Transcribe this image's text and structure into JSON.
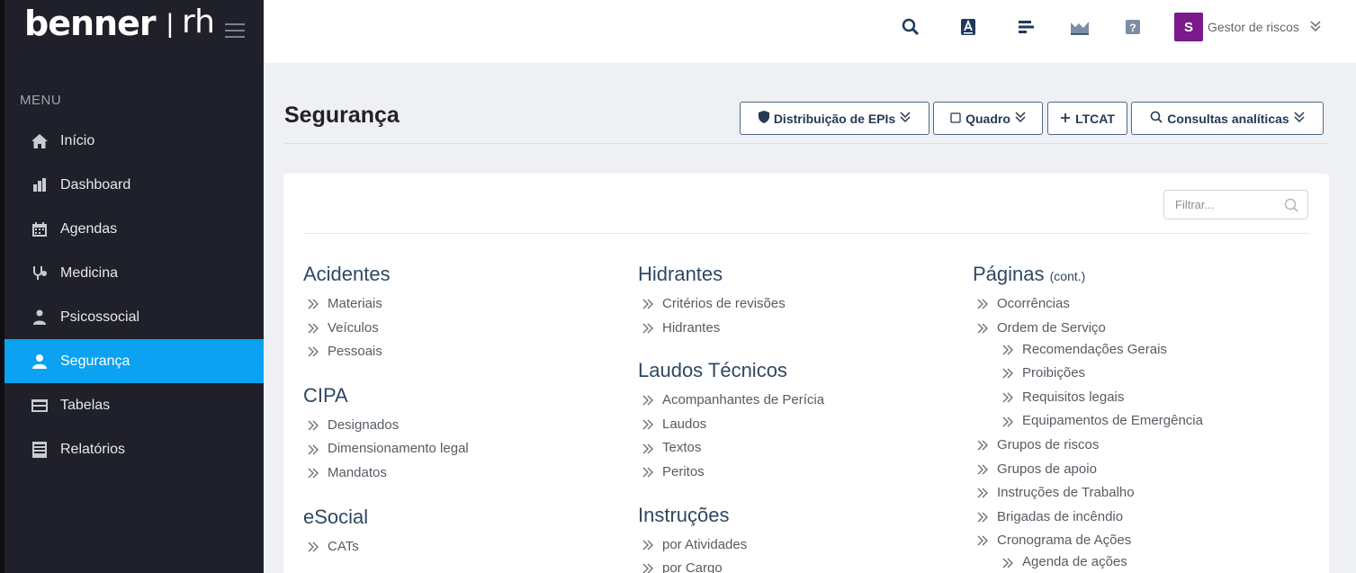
{
  "brand": {
    "name": "benner",
    "separator": "|",
    "product": "rh"
  },
  "sidebar": {
    "menu_title": "MENU",
    "items": [
      {
        "label": "Início",
        "icon": "home-icon"
      },
      {
        "label": "Dashboard",
        "icon": "bar-chart-icon"
      },
      {
        "label": "Agendas",
        "icon": "calendar-icon"
      },
      {
        "label": "Medicina",
        "icon": "stethoscope-icon"
      },
      {
        "label": "Psicossocial",
        "icon": "people-icon"
      },
      {
        "label": "Segurança",
        "icon": "user-icon",
        "active": true
      },
      {
        "label": "Tabelas",
        "icon": "table-icon"
      },
      {
        "label": "Relatórios",
        "icon": "report-icon"
      }
    ]
  },
  "topbar": {
    "icons": [
      "search-icon",
      "font-icon",
      "list-icon",
      "chart-icon",
      "help-icon"
    ],
    "user": {
      "initial": "S",
      "name": "Gestor de riscos"
    }
  },
  "page": {
    "title": "Segurança",
    "buttons": {
      "epis": "Distribuição de EPIs",
      "quadro": "Quadro",
      "ltcat": "LTCAT",
      "consultas": "Consultas analíticas"
    }
  },
  "filter": {
    "placeholder": "Filtrar..."
  },
  "sections": {
    "acidentes": {
      "title": "Acidentes",
      "links": [
        "Materiais",
        "Veículos",
        "Pessoais"
      ]
    },
    "cipa": {
      "title": "CIPA",
      "links": [
        "Designados",
        "Dimensionamento legal",
        "Mandatos"
      ]
    },
    "esocial": {
      "title": "eSocial",
      "links": [
        "CATs"
      ]
    },
    "hidrantes": {
      "title": "Hidrantes",
      "links": [
        "Critérios de revisões",
        "Hidrantes"
      ]
    },
    "laudos": {
      "title": "Laudos Técnicos",
      "links": [
        "Acompanhantes de Perícia",
        "Laudos",
        "Textos",
        "Peritos"
      ]
    },
    "instrucoes": {
      "title": "Instruções",
      "links": [
        "por Atividades",
        "por Cargo"
      ]
    },
    "paginas": {
      "title": "Páginas",
      "cont": "(cont.)",
      "links": [
        "Ocorrências",
        "Ordem de Serviço",
        "Recomendações Gerais",
        "Proibições",
        "Requisitos legais",
        "Equipamentos de Emergência",
        "Grupos de riscos",
        "Grupos de apoio",
        "Instruções de Trabalho",
        "Brigadas de incêndio",
        "Cronograma de Ações",
        "Agenda de ações"
      ]
    }
  },
  "colors": {
    "accent": "#0aa2f1",
    "sidebar": "#1f2029",
    "avatar": "#7a1a8c",
    "heading": "#2f4863"
  }
}
